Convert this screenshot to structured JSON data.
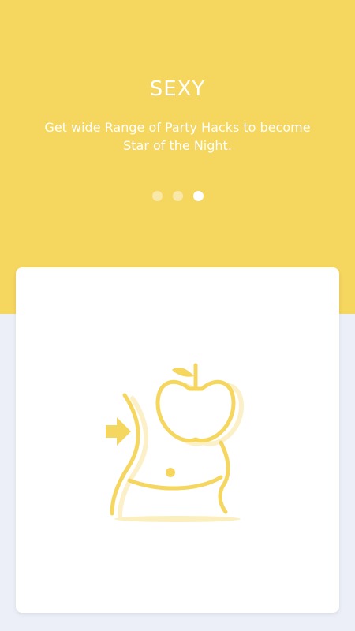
{
  "onboarding": {
    "title": "SEXY",
    "description": "Get wide Range of Party Hacks to become Star of the Night.",
    "pager": {
      "total": 3,
      "active_index": 2
    }
  },
  "illustration": {
    "icon": "waist-apple-icon",
    "color": "#f5d65f"
  },
  "colors": {
    "accent": "#f5d65f",
    "background": "#eceff8",
    "card": "#ffffff"
  }
}
